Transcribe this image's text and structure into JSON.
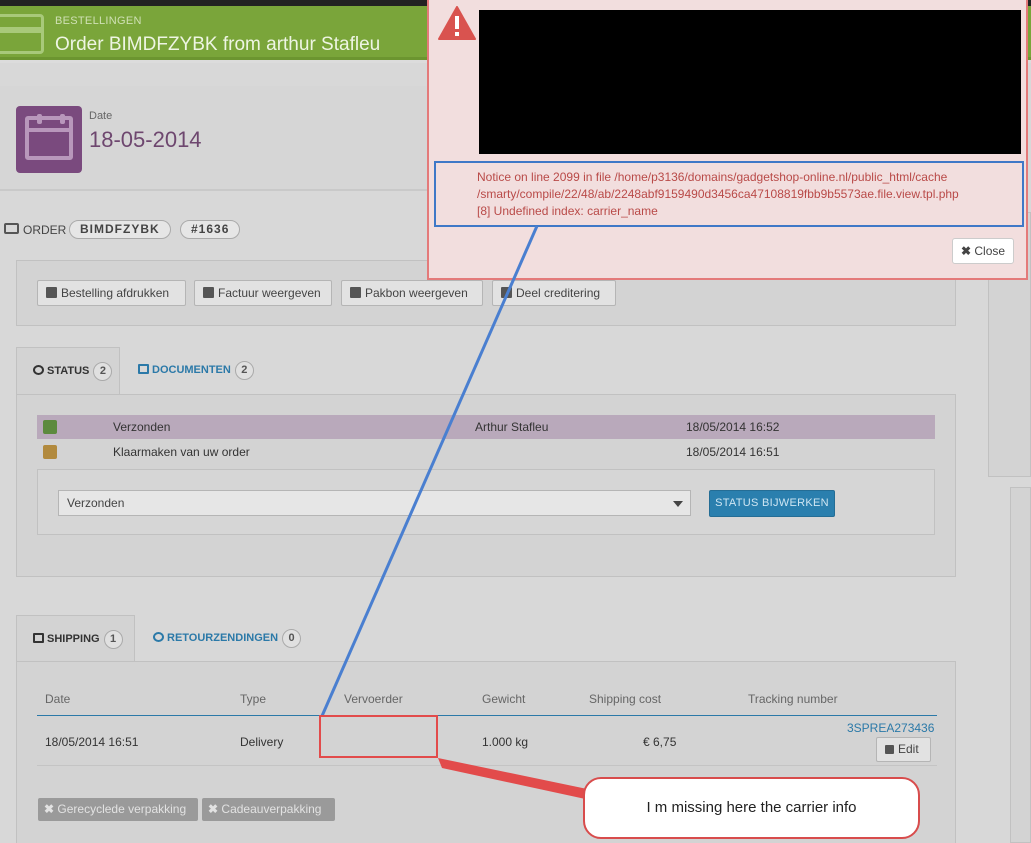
{
  "header": {
    "breadcrumb": "BESTELLINGEN",
    "title": "Order BIMDFZYBK from arthur Stafleu"
  },
  "date_card": {
    "label": "Date",
    "value": "18-05-2014"
  },
  "order": {
    "label": "ORDER",
    "reference": "BIMDFZYBK",
    "number": "#1636"
  },
  "actions": {
    "print": "Bestelling afdrukken",
    "invoice": "Factuur weergeven",
    "packing_slip": "Pakbon weergeven",
    "partial_refund": "Deel creditering"
  },
  "status_tabs": [
    {
      "label": "STATUS",
      "count": "2"
    },
    {
      "label": "DOCUMENTEN",
      "count": "2"
    }
  ],
  "status_history": [
    {
      "status": "Verzonden",
      "employee": "Arthur Stafleu",
      "date": "18/05/2014 16:52"
    },
    {
      "status": "Klaarmaken van uw order",
      "employee": "",
      "date": "18/05/2014 16:51"
    }
  ],
  "status_form": {
    "selected": "Verzonden",
    "submit": "STATUS BIJWERKEN"
  },
  "shipping_tabs": [
    {
      "label": "SHIPPING",
      "count": "1"
    },
    {
      "label": "RETOURZENDINGEN",
      "count": "0"
    }
  ],
  "shipping_table": {
    "headers": [
      "Date",
      "Type",
      "Vervoerder",
      "Gewicht",
      "Shipping cost",
      "Tracking number"
    ],
    "row": {
      "date": "18/05/2014 16:51",
      "type": "Delivery",
      "carrier": "",
      "weight": "1.000 kg",
      "cost": "€ 6,75",
      "tracking": "3SPREA273436",
      "edit": "Edit"
    }
  },
  "tags": {
    "recycled": "Gerecyclede verpakking",
    "gift": "Cadeauverpakking"
  },
  "modal": {
    "notice_lines": [
      "Notice on line 2099 in file /home/p3136/domains/gadgetshop-online.nl/public_html/cache",
      "/smarty/compile/22/48/ab/2248abf9159490d3456ca47108819fbb9b5573ae.file.view.tpl.php",
      "[8] Undefined index: carrier_name"
    ],
    "close": "Close"
  },
  "callout": "I m missing here the carrier info",
  "colors": {
    "header_green": "#7aa53a",
    "modal_bg": "#f2dede",
    "notice_red": "#b94a48",
    "annotation_blue": "#3f78c7",
    "annotation_red": "#e24b4b"
  }
}
